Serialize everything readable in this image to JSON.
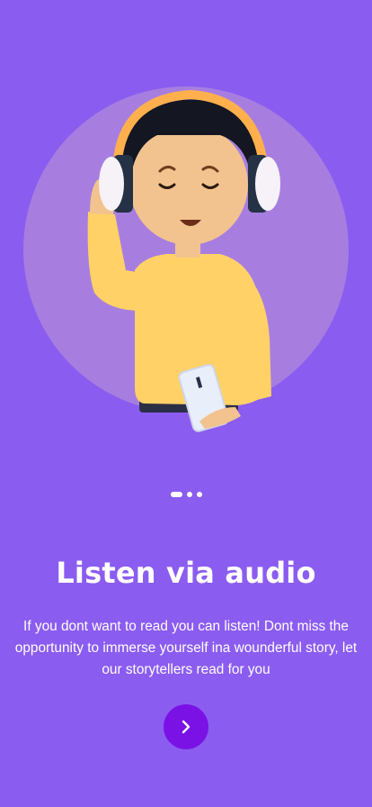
{
  "onboarding": {
    "title": "Listen via audio",
    "description": "If you dont want to read you can listen! Dont miss the opportunity to immerse yourself ina wounderful story, let our storytellers read for you",
    "page_indicator": {
      "total": 3,
      "active": 1
    },
    "next_icon": "chevron-right-icon"
  },
  "colors": {
    "background": "#8b5cf0",
    "circle": "#a77ee0",
    "button": "#7a12e6",
    "sweater": "#ffd166",
    "headphones": "#ffb04d"
  }
}
